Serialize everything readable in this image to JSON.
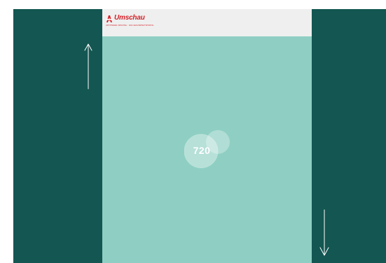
{
  "header": {
    "brand": "Umschau",
    "brand_tagline": "APOTHEKEN UMSCHAU · DAS GESUNDHEITSPORTAL"
  },
  "badge": {
    "value": "720"
  },
  "arrows": {
    "left": "arrow-up-icon",
    "right": "arrow-down-icon"
  },
  "colors": {
    "frame": "#135652",
    "content": "#8fcfc3",
    "topbar": "#efefef",
    "brand": "#d2232a"
  }
}
